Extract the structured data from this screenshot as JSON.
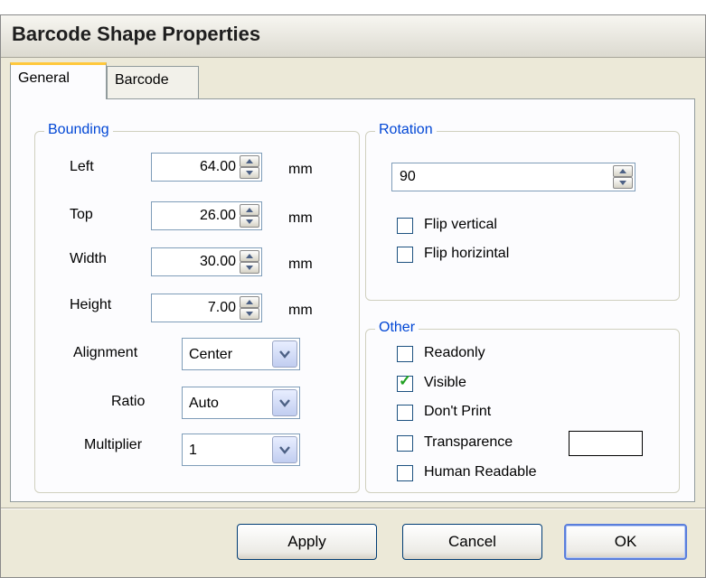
{
  "window": {
    "title": "Barcode Shape Properties"
  },
  "tabs": [
    {
      "label": "General",
      "active": true
    },
    {
      "label": "Barcode",
      "active": false
    }
  ],
  "bounding": {
    "legend": "Bounding",
    "unit": "mm",
    "fields": [
      {
        "label": "Left",
        "value": "64.00"
      },
      {
        "label": "Top",
        "value": "26.00"
      },
      {
        "label": "Width",
        "value": "30.00"
      },
      {
        "label": "Height",
        "value": "7.00"
      }
    ],
    "alignment": {
      "label": "Alignment",
      "value": "Center"
    },
    "ratio": {
      "label": "Ratio",
      "value": "Auto"
    },
    "multiplier": {
      "label": "Multiplier",
      "value": "1"
    }
  },
  "rotation": {
    "legend": "Rotation",
    "value": "90",
    "flip_vertical": {
      "label": "Flip vertical",
      "checked": false
    },
    "flip_horizontal": {
      "label": "Flip horizintal",
      "checked": false
    }
  },
  "other": {
    "legend": "Other",
    "readonly": {
      "label": "Readonly",
      "checked": false
    },
    "visible": {
      "label": "Visible",
      "checked": true,
      "mark": "✓"
    },
    "dont_print": {
      "label": "Don't Print",
      "checked": false
    },
    "transparence": {
      "label": "Transparence",
      "checked": false,
      "color": "#ffffff"
    },
    "human_readable": {
      "label": "Human Readable",
      "checked": false
    }
  },
  "buttons": {
    "apply": "Apply",
    "cancel": "Cancel",
    "ok": "OK"
  },
  "icons": {
    "spin": "spin-up-down-icon",
    "dropdown": "chevron-down-icon",
    "check": "check-mark-icon"
  }
}
